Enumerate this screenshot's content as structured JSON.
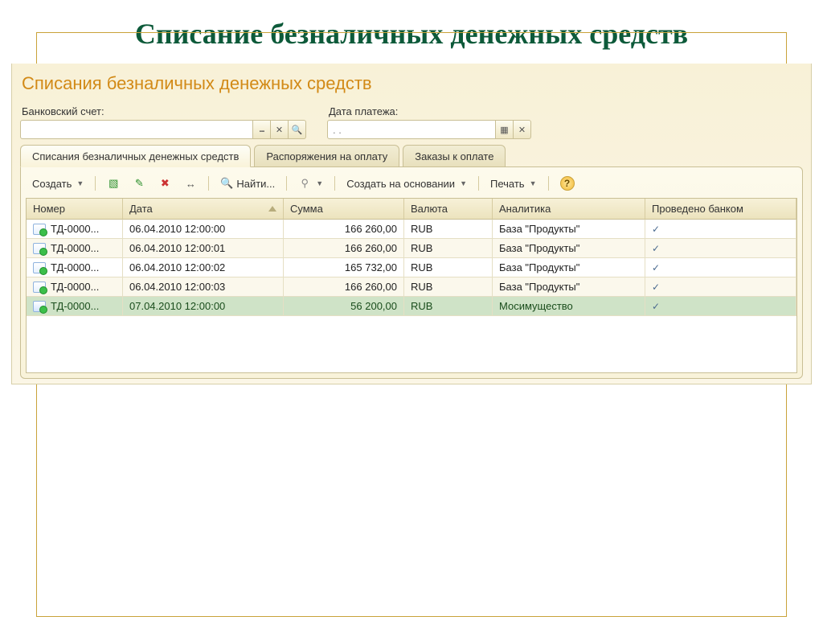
{
  "slide_title": "Списание безналичных денежных средств",
  "panel_title": "Списания безналичных денежных средств",
  "filters": {
    "bank_label": "Банковский счет:",
    "bank_value": "",
    "date_label": "Дата платежа:",
    "date_value": ". ."
  },
  "tabs": {
    "t1": "Списания безналичных денежных средств",
    "t2": "Распоряжения на оплату",
    "t3": "Заказы к оплате"
  },
  "toolbar": {
    "create": "Создать",
    "find": "Найти...",
    "create_based": "Создать на основании",
    "print": "Печать"
  },
  "columns": {
    "num": "Номер",
    "date": "Дата",
    "sum": "Сумма",
    "cur": "Валюта",
    "ana": "Аналитика",
    "bank": "Проведено банком"
  },
  "rows": [
    {
      "num": "ТД-0000...",
      "date": "06.04.2010 12:00:00",
      "sum": "166 260,00",
      "cur": "RUB",
      "ana": "База \"Продукты\"",
      "bank": "✓"
    },
    {
      "num": "ТД-0000...",
      "date": "06.04.2010 12:00:01",
      "sum": "166 260,00",
      "cur": "RUB",
      "ana": "База \"Продукты\"",
      "bank": "✓"
    },
    {
      "num": "ТД-0000...",
      "date": "06.04.2010 12:00:02",
      "sum": "165 732,00",
      "cur": "RUB",
      "ana": "База \"Продукты\"",
      "bank": "✓"
    },
    {
      "num": "ТД-0000...",
      "date": "06.04.2010 12:00:03",
      "sum": "166 260,00",
      "cur": "RUB",
      "ana": "База \"Продукты\"",
      "bank": "✓"
    },
    {
      "num": "ТД-0000...",
      "date": "07.04.2010 12:00:00",
      "sum": "56 200,00",
      "cur": "RUB",
      "ana": "Мосимущество",
      "bank": "✓"
    }
  ]
}
